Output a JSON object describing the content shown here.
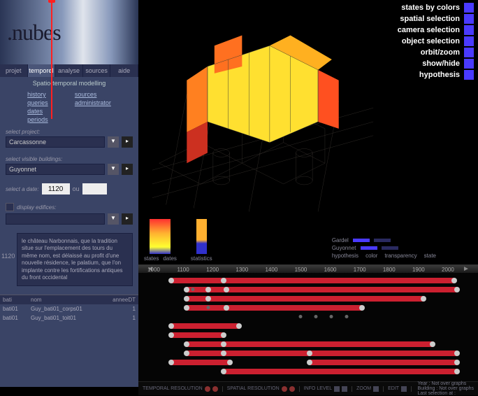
{
  "logo": ".nubes",
  "tabs": [
    "projet",
    "temporel",
    "analyse",
    "sources",
    "aide"
  ],
  "active_tab": 1,
  "panel_title": "Spatio-temporal modelling",
  "submenu_left": [
    "history",
    "queries",
    "dates",
    "periods"
  ],
  "submenu_right": [
    "sources",
    "administrator"
  ],
  "select_project_label": "select project:",
  "select_project_value": "Carcassonne",
  "select_buildings_label": "select visible buildings:",
  "select_buildings_value": "Guyonnet",
  "select_date_label": "select a date:",
  "date_value": "1120",
  "date_ou": "ou",
  "display_edifices_label": "display edifices:",
  "display_edifices_value": "",
  "desc_year": "1120",
  "desc_text": "le château Narbonnais, que la tradition situe sur l'emplacement des tours du même nom, est délaissé au profit d'une nouvelle résidence, le palatium, que l'on implante contre les fortifications antiques du front occidental",
  "table_headers": {
    "bati": "bati",
    "nom": "nom",
    "annee": "anneeDT"
  },
  "table_rows": [
    {
      "bati": "bati01",
      "nom": "Guy_bati01_corps01",
      "annee": "1"
    },
    {
      "bati": "bati01",
      "nom": "Guy_bati01_toit01",
      "annee": "1"
    }
  ],
  "right_legend": [
    {
      "color": "#4a3aff",
      "label": "states by colors"
    },
    {
      "color": "#4a3aff",
      "label": "spatial selection"
    },
    {
      "color": "#4a3aff",
      "label": "camera selection"
    },
    {
      "color": "#4a3aff",
      "label": "object selection"
    },
    {
      "color": "#4a3aff",
      "label": "orbit/zoom"
    },
    {
      "color": "#4a3aff",
      "label": "show/hide"
    },
    {
      "color": "#4a3aff",
      "label": "hypothesis"
    }
  ],
  "gradient_labels": {
    "g1a": "states",
    "g1b": "dates",
    "g2": "statistics"
  },
  "hypothesis_legend": {
    "rows": [
      {
        "name": "Gardel",
        "color": "#4a3aff"
      },
      {
        "name": "Guyonnet",
        "color": "#4a3aff"
      }
    ],
    "headers": [
      "hypothesis",
      "color",
      "transparency",
      "state"
    ]
  },
  "timeline": {
    "start": 1000,
    "end": 2050,
    "step": 100,
    "marker": 1120,
    "ticks": [
      "1000",
      "1100",
      "1200",
      "1300",
      "1400",
      "1500",
      "1600",
      "1700",
      "1800",
      "1900",
      "2000"
    ],
    "tracks": [
      {
        "bars": [
          [
            1080,
            2000
          ]
        ],
        "dots": [
          1080,
          1250,
          2000
        ]
      },
      {
        "bars": [
          [
            1130,
            2010
          ]
        ],
        "dots": [
          1130,
          1200,
          1260,
          2010
        ],
        "smdots": [
          1150
        ]
      },
      {
        "bars": [
          [
            1130,
            1900
          ]
        ],
        "dots": [
          1130,
          1200,
          1900
        ]
      },
      {
        "bars": [
          [
            1130,
            1700
          ]
        ],
        "dots": [
          1130,
          1260,
          1700
        ],
        "smdots": [
          1200
        ]
      },
      {
        "bars": [],
        "dots": [],
        "smdots": [
          1500,
          1550,
          1600,
          1650
        ]
      },
      {
        "bars": [
          [
            1080,
            1300
          ]
        ],
        "dots": [
          1080,
          1300
        ]
      },
      {
        "bars": [
          [
            1080,
            1250
          ]
        ],
        "dots": [
          1080,
          1250
        ]
      },
      {
        "bars": [
          [
            1130,
            1930
          ]
        ],
        "dots": [
          1130,
          1250,
          1930
        ]
      },
      {
        "bars": [
          [
            1130,
            2010
          ]
        ],
        "dots": [
          1130,
          1250,
          1530,
          2010
        ]
      },
      {
        "bars": [
          [
            1080,
            1270
          ],
          [
            1530,
            2010
          ]
        ],
        "dots": [
          1080,
          1270,
          1530,
          2010
        ]
      },
      {
        "bars": [
          [
            1250,
            2010
          ]
        ],
        "dots": [
          1250,
          2010
        ]
      }
    ]
  },
  "bottom_bar": {
    "temporal": "TEMPORAL RESOLUTION",
    "spatial": "SPATIAL RESOLUTION",
    "info": "INFO LEVEL",
    "zoom": "ZOOM",
    "edit": "EDIT",
    "year_label": "Year : Not over graphs",
    "building_label": "Building : Not over graphs",
    "last_sel": "Last selection at :"
  }
}
